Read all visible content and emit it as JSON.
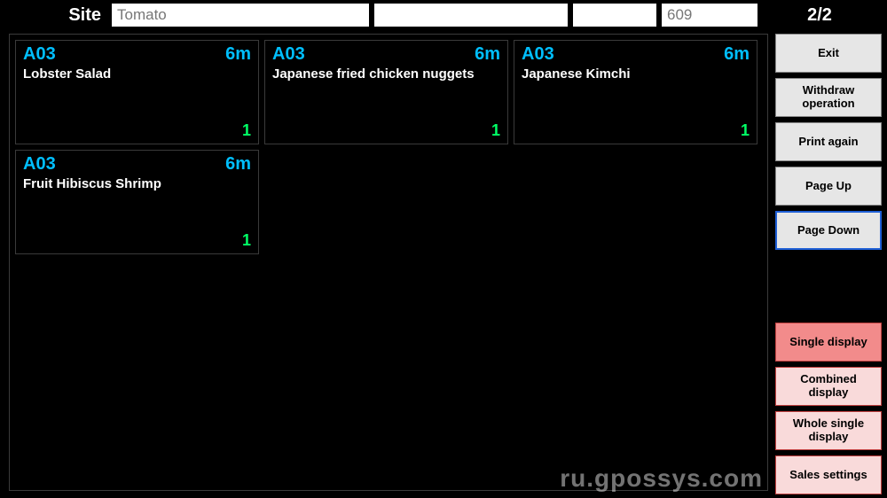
{
  "header": {
    "site_label": "Site",
    "site_value": "Tomato",
    "field2": "",
    "field3": "",
    "num_value": "609",
    "page_indicator": "2/2"
  },
  "orders": [
    {
      "code": "A03",
      "time": "6m",
      "name": "Lobster Salad",
      "qty": "1"
    },
    {
      "code": "A03",
      "time": "6m",
      "name": "Japanese fried chicken nuggets",
      "qty": "1"
    },
    {
      "code": "A03",
      "time": "6m",
      "name": "Japanese Kimchi",
      "qty": "1"
    },
    {
      "code": "A03",
      "time": "6m",
      "name": "Fruit Hibiscus Shrimp",
      "qty": "1"
    }
  ],
  "sidebar": {
    "exit": "Exit",
    "withdraw": "Withdraw operation",
    "print": "Print again",
    "pageup": "Page Up",
    "pagedown": "Page Down",
    "single": "Single display",
    "combined": "Combined display",
    "whole": "Whole single display",
    "sales": "Sales settings"
  },
  "watermark": "ru.gpossys.com"
}
